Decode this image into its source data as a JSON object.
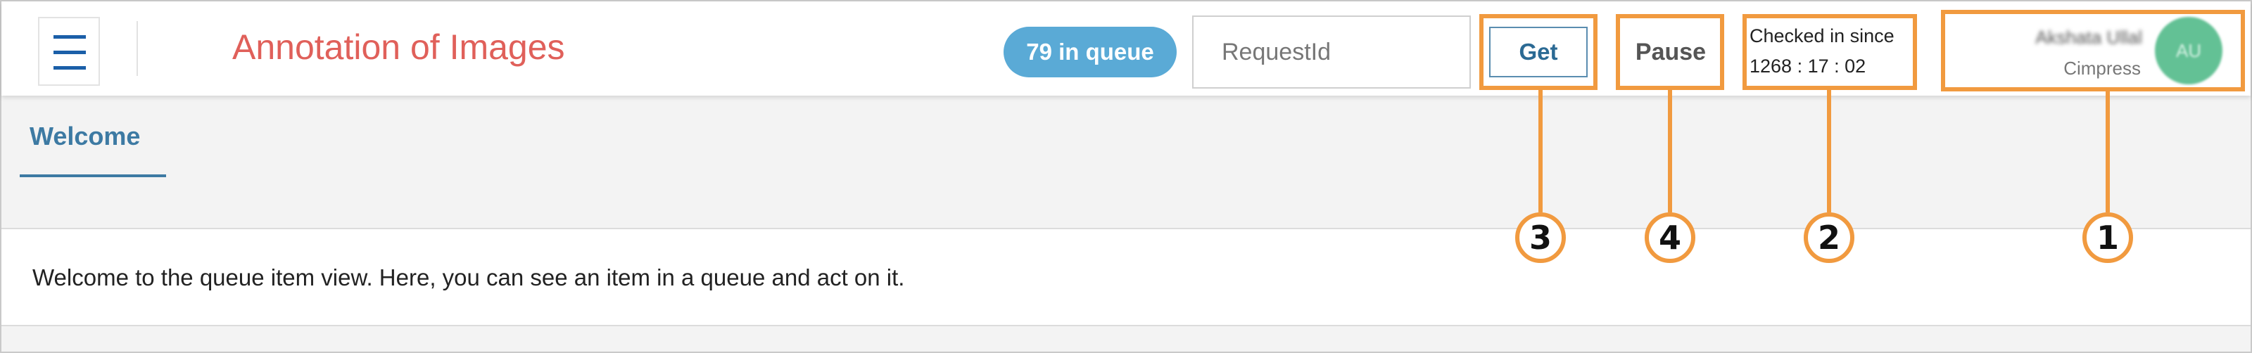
{
  "header": {
    "app_title": "Annotation of Images",
    "queue_badge": "79 in queue",
    "request_placeholder": "RequestId",
    "get_label": "Get",
    "pause_label": "Pause",
    "checkin_label": "Checked in since",
    "checkin_time": "1268 : 17 : 02",
    "user_name": "Akshata Ullal",
    "user_org": "Cimpress",
    "avatar_initials": "AU"
  },
  "tabs": [
    {
      "label": "Welcome",
      "active": true
    }
  ],
  "main": {
    "welcome_text": "Welcome to the queue item view. Here, you can see an item in a queue and act on it."
  },
  "callouts": [
    {
      "number": "1",
      "target": "user-profile"
    },
    {
      "number": "2",
      "target": "checked-in-timer"
    },
    {
      "number": "3",
      "target": "get-button"
    },
    {
      "number": "4",
      "target": "pause-button"
    }
  ],
  "colors": {
    "accent_orange": "#f19a3f",
    "queue_badge": "#5aaad6",
    "title_red": "#e0605a",
    "avatar_green": "#63c195",
    "tab_blue": "#3d7aa3"
  },
  "icons": {
    "menu": "hamburger-menu-icon"
  }
}
